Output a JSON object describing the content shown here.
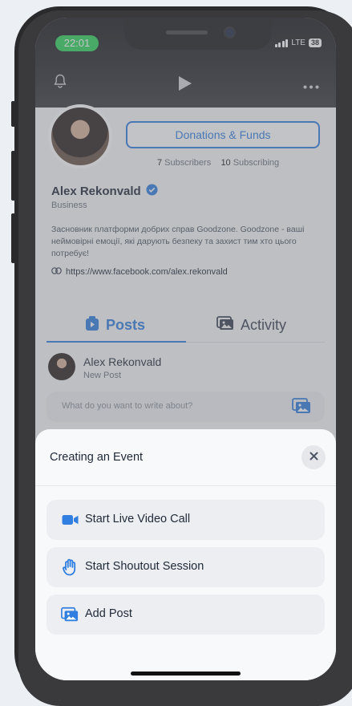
{
  "status_bar": {
    "time": "22:01",
    "network": "LTE",
    "battery": "38"
  },
  "profile": {
    "donate_label": "Donations & Funds",
    "subscribers_count": "7",
    "subscribers_label": "Subscribers",
    "subscribing_count": "10",
    "subscribing_label": "Subscribing",
    "name": "Alex Rekonvald",
    "role": "Business",
    "bio": "Засновник платформи добрих справ Goodzone. Goodzone - ваші неймовірні емоції, які дарують безпеку та захист тим хто цього потребує!",
    "link": "https://www.facebook.com/alex.rekonvald"
  },
  "tabs": [
    {
      "label": "Posts",
      "icon": "posts-icon"
    },
    {
      "label": "Activity",
      "icon": "activity-icon"
    }
  ],
  "composer": {
    "author": "Alex Rekonvald",
    "subtitle": "New Post",
    "placeholder": "What do you want to write about?"
  },
  "sheet": {
    "title": "Creating an Event",
    "options": [
      {
        "label": "Start Live Video Call",
        "icon": "video-camera-icon"
      },
      {
        "label": "Start Shoutout Session",
        "icon": "waving-hand-icon"
      },
      {
        "label": "Add Post",
        "icon": "gallery-icon"
      }
    ]
  },
  "colors": {
    "accent": "#2f7ee0",
    "status_pill": "#2fd25a"
  }
}
